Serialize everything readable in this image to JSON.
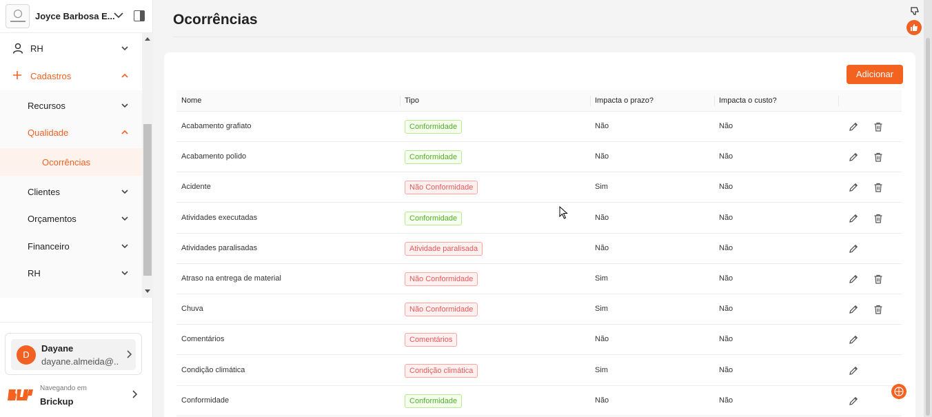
{
  "sidebar": {
    "company": "Joyce Barbosa E...",
    "menu": [
      {
        "label": "RH",
        "icon": "user-icon"
      },
      {
        "label": "Cadastros",
        "icon": "plus-icon"
      },
      {
        "label": "Recursos"
      },
      {
        "label": "Qualidade"
      },
      {
        "label": "Ocorrências"
      },
      {
        "label": "Clientes"
      },
      {
        "label": "Orçamentos"
      },
      {
        "label": "Financeiro"
      },
      {
        "label": "RH"
      }
    ],
    "user": {
      "initial": "D",
      "name": "Dayane",
      "email": "dayane.almeida@..."
    },
    "navigating_label": "Navegando em",
    "navigating_company": "Brickup"
  },
  "page": {
    "title": "Ocorrências",
    "add_label": "Adicionar"
  },
  "table": {
    "headers": [
      "Nome",
      "Tipo",
      "Impacta o prazo?",
      "Impacta o custo?"
    ],
    "rows": [
      {
        "nome": "Acabamento grafiato",
        "tipo": "Conformidade",
        "tone": "green",
        "prazo": "Não",
        "custo": "Não",
        "deletable": true
      },
      {
        "nome": "Acabamento polido",
        "tipo": "Conformidade",
        "tone": "green",
        "prazo": "Não",
        "custo": "Não",
        "deletable": true
      },
      {
        "nome": "Acidente",
        "tipo": "Não Conformidade",
        "tone": "red",
        "prazo": "Sim",
        "custo": "Não",
        "deletable": true
      },
      {
        "nome": "Atividades executadas",
        "tipo": "Conformidade",
        "tone": "green",
        "prazo": "Não",
        "custo": "Não",
        "deletable": true
      },
      {
        "nome": "Atividades paralisadas",
        "tipo": "Atividade paralisada",
        "tone": "red",
        "prazo": "Não",
        "custo": "Não",
        "deletable": false
      },
      {
        "nome": "Atraso na entrega de material",
        "tipo": "Não Conformidade",
        "tone": "red",
        "prazo": "Sim",
        "custo": "Não",
        "deletable": true
      },
      {
        "nome": "Chuva",
        "tipo": "Não Conformidade",
        "tone": "red",
        "prazo": "Sim",
        "custo": "Não",
        "deletable": true
      },
      {
        "nome": "Comentários",
        "tipo": "Comentários",
        "tone": "red",
        "prazo": "Não",
        "custo": "Não",
        "deletable": false
      },
      {
        "nome": "Condição climática",
        "tipo": "Condição climática",
        "tone": "red",
        "prazo": "Sim",
        "custo": "Não",
        "deletable": false
      },
      {
        "nome": "Conformidade",
        "tipo": "Conformidade",
        "tone": "green",
        "prazo": "Não",
        "custo": "Não",
        "deletable": false
      }
    ]
  },
  "colors": {
    "accent": "#f4621f",
    "tag_green": "#52b02a",
    "tag_red": "#e8585a"
  }
}
